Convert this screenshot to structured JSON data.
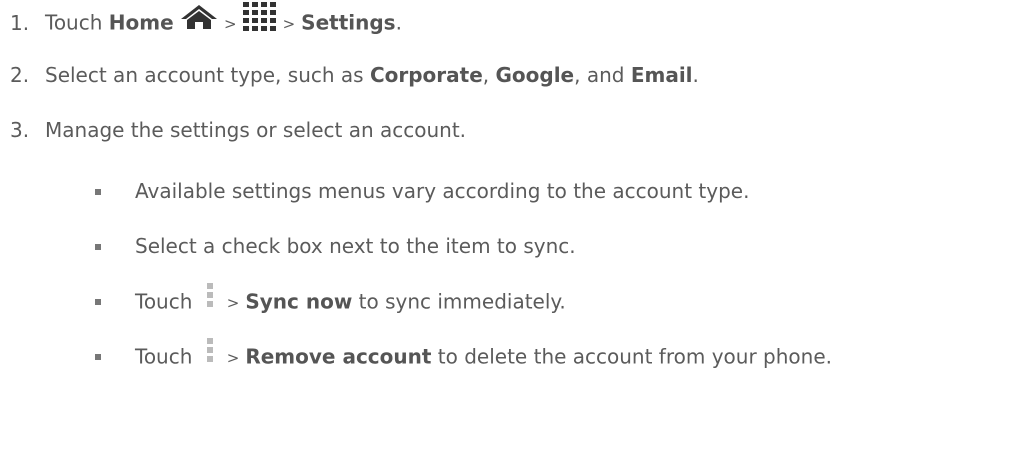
{
  "steps": [
    {
      "num": "1.",
      "t1": "Touch ",
      "home": "Home",
      "gt1": ">",
      "gt2": ">",
      "settings": "Settings",
      "end": "."
    },
    {
      "num": "2.",
      "t1": "Select an account type, such as ",
      "corp": "Corporate",
      "c1": ", ",
      "google": "Google",
      "c2": ", and ",
      "email": "Email",
      "end": "."
    },
    {
      "num": "3.",
      "text": "Manage the settings or select an account."
    }
  ],
  "bullets": [
    {
      "text": "Available settings menus vary according to the account type."
    },
    {
      "text": "Select a check box next to the item to sync."
    },
    {
      "t1": "Touch ",
      "gt": ">",
      "bold": "Sync now",
      "t2": " to sync immediately."
    },
    {
      "t1": "Touch ",
      "gt": ">",
      "bold": "Remove account",
      "t2": " to delete the account from your phone."
    }
  ],
  "icons": {
    "home": "home-icon",
    "apps": "apps-grid-icon",
    "menu": "menu-icon"
  },
  "colors": {
    "text": "#5b5b5b",
    "icon": "#333333",
    "menu_icon": "#bbbbbb"
  }
}
